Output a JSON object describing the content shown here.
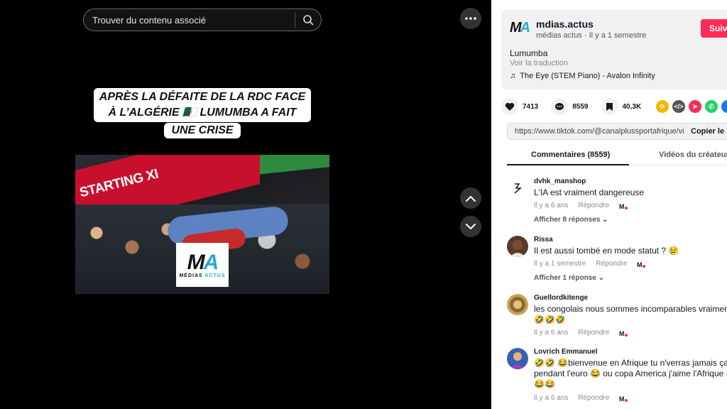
{
  "search": {
    "placeholder": "Trouver du contenu associé"
  },
  "video": {
    "caption_line1": "APRÈS LA DÉFAITE DE LA RDC FACE",
    "caption_line2": "À L’ALGÉRIE 🇩🇿 LUMUMBA A FAIT",
    "caption_line3": "UNE CRISE",
    "banner_text": "STARTING XI",
    "logo_mark": "MA",
    "logo_sub_left": "MÉDIAS",
    "logo_sub_right": "ACTUS"
  },
  "author": {
    "logo": "MA",
    "name": "mdias.actus",
    "meta": "médias actus · Il y a 1 semestre",
    "follow_label": "Suivre"
  },
  "post": {
    "description": "Lumumba",
    "translate_label": "Voir la traduction",
    "music": "The Eye (STEM Piano) - Avalon Infinity"
  },
  "actions": {
    "likes": "7413",
    "comments": "8559",
    "saves": "40,3K"
  },
  "share": {
    "url": "https://www.tiktok.com/@canalplussportafrique/vi...",
    "copy_label": "Copier le lien"
  },
  "tabs": {
    "comments": "Commentaires (8559)",
    "creator_videos": "Vidéos du créateur"
  },
  "comments": [
    {
      "user": "dvhk_manshop",
      "text": "L'IA est vraiment dangereuse",
      "time": "Il y a 6 ans",
      "reply_label": "Répondre",
      "more": "Afficher 8 réponses"
    },
    {
      "user": "Rissa",
      "text": "Il est aussi tombé en mode statut ? 😢",
      "time": "Il y a 1 semestre",
      "reply_label": "Répondre",
      "more": "Afficher 1 réponse"
    },
    {
      "user": "Guellordkitenge",
      "text": "les congolais nous sommes incomparables vraiment 🤣🤣🤣🤣",
      "time": "Il y a 6 ans",
      "reply_label": "Répondre"
    },
    {
      "user": "Lovrich Emmanuel",
      "text": "🤣🤣 😂bienvenue en Afrique tu n'verras jamais ça pendant l'euro 😂 ou copa America j'aime l'Afrique 😂😂😂",
      "time": "Il y a 6 ans",
      "reply_label": "Répondre"
    }
  ],
  "colors": {
    "accent": "#fe2c55",
    "brand_blue": "#2aa6d8",
    "panel_bg": "#ffffff",
    "player_bg": "#000000"
  }
}
